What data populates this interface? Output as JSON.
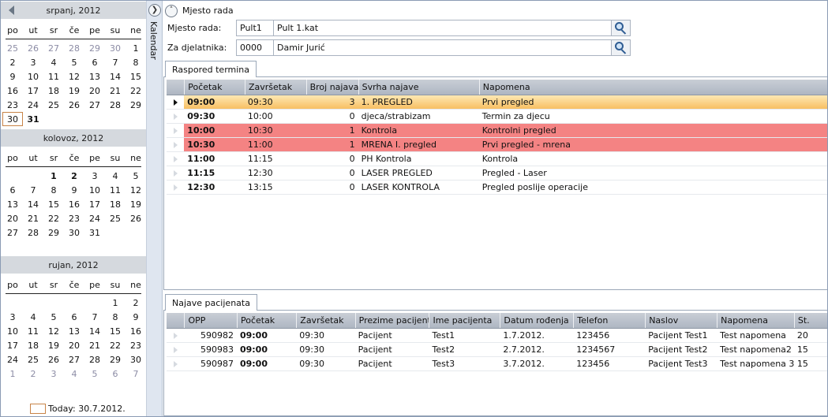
{
  "calendar": {
    "months": [
      {
        "title": "srpanj, 2012",
        "weekdays": [
          "po",
          "ut",
          "sr",
          "če",
          "pe",
          "su",
          "ne"
        ],
        "days": [
          {
            "d": "25",
            "o": true
          },
          {
            "d": "26",
            "o": true
          },
          {
            "d": "27",
            "o": true
          },
          {
            "d": "28",
            "o": true
          },
          {
            "d": "29",
            "o": true
          },
          {
            "d": "30",
            "o": true
          },
          {
            "d": "1"
          },
          {
            "d": "2"
          },
          {
            "d": "3"
          },
          {
            "d": "4"
          },
          {
            "d": "5"
          },
          {
            "d": "6"
          },
          {
            "d": "7"
          },
          {
            "d": "8"
          },
          {
            "d": "9"
          },
          {
            "d": "10"
          },
          {
            "d": "11"
          },
          {
            "d": "12"
          },
          {
            "d": "13"
          },
          {
            "d": "14"
          },
          {
            "d": "15"
          },
          {
            "d": "16"
          },
          {
            "d": "17"
          },
          {
            "d": "18"
          },
          {
            "d": "19"
          },
          {
            "d": "20"
          },
          {
            "d": "21"
          },
          {
            "d": "22"
          },
          {
            "d": "23"
          },
          {
            "d": "24"
          },
          {
            "d": "25"
          },
          {
            "d": "26"
          },
          {
            "d": "27"
          },
          {
            "d": "28"
          },
          {
            "d": "29"
          },
          {
            "d": "30",
            "sel": true
          },
          {
            "d": "31",
            "b": true
          }
        ]
      },
      {
        "title": "kolovoz, 2012",
        "weekdays": [
          "po",
          "ut",
          "sr",
          "če",
          "pe",
          "su",
          "ne"
        ],
        "days": [
          {
            "d": "",
            "e": true
          },
          {
            "d": "",
            "e": true
          },
          {
            "d": "1",
            "b": true
          },
          {
            "d": "2",
            "b": true
          },
          {
            "d": "3"
          },
          {
            "d": "4"
          },
          {
            "d": "5"
          },
          {
            "d": "6"
          },
          {
            "d": "7"
          },
          {
            "d": "8"
          },
          {
            "d": "9"
          },
          {
            "d": "10"
          },
          {
            "d": "11"
          },
          {
            "d": "12"
          },
          {
            "d": "13"
          },
          {
            "d": "14"
          },
          {
            "d": "15"
          },
          {
            "d": "16"
          },
          {
            "d": "17"
          },
          {
            "d": "18"
          },
          {
            "d": "19"
          },
          {
            "d": "20"
          },
          {
            "d": "21"
          },
          {
            "d": "22"
          },
          {
            "d": "23"
          },
          {
            "d": "24"
          },
          {
            "d": "25"
          },
          {
            "d": "26"
          },
          {
            "d": "27"
          },
          {
            "d": "28"
          },
          {
            "d": "29"
          },
          {
            "d": "30"
          },
          {
            "d": "31"
          }
        ]
      },
      {
        "title": "rujan, 2012",
        "weekdays": [
          "po",
          "ut",
          "sr",
          "če",
          "pe",
          "su",
          "ne"
        ],
        "days": [
          {
            "d": "",
            "e": true
          },
          {
            "d": "",
            "e": true
          },
          {
            "d": "",
            "e": true
          },
          {
            "d": "",
            "e": true
          },
          {
            "d": "",
            "e": true
          },
          {
            "d": "1"
          },
          {
            "d": "2"
          },
          {
            "d": "3"
          },
          {
            "d": "4"
          },
          {
            "d": "5"
          },
          {
            "d": "6"
          },
          {
            "d": "7"
          },
          {
            "d": "8"
          },
          {
            "d": "9"
          },
          {
            "d": "10"
          },
          {
            "d": "11"
          },
          {
            "d": "12"
          },
          {
            "d": "13"
          },
          {
            "d": "14"
          },
          {
            "d": "15"
          },
          {
            "d": "16"
          },
          {
            "d": "17"
          },
          {
            "d": "18"
          },
          {
            "d": "19"
          },
          {
            "d": "20"
          },
          {
            "d": "21"
          },
          {
            "d": "22"
          },
          {
            "d": "23"
          },
          {
            "d": "24"
          },
          {
            "d": "25"
          },
          {
            "d": "26"
          },
          {
            "d": "27"
          },
          {
            "d": "28"
          },
          {
            "d": "29"
          },
          {
            "d": "30"
          },
          {
            "d": "1",
            "o": true
          },
          {
            "d": "2",
            "o": true
          },
          {
            "d": "3",
            "o": true
          },
          {
            "d": "4",
            "o": true
          },
          {
            "d": "5",
            "o": true
          },
          {
            "d": "6",
            "o": true
          },
          {
            "d": "7",
            "o": true
          }
        ]
      }
    ],
    "today_label": "Today: 30.7.2012."
  },
  "strip": {
    "label": "Kalendar"
  },
  "header": {
    "title": "Mjesto rada"
  },
  "filters": {
    "mjesto": {
      "label": "Mjesto rada:",
      "code": "Pult1",
      "name": "Pult 1.kat"
    },
    "djelatnik": {
      "label": "Za djelatnika:",
      "code": "0000",
      "name": "Damir Jurić"
    }
  },
  "raspored": {
    "tab": "Raspored termina",
    "columns": [
      "Početak",
      "Završetak",
      "Broj najava",
      "Svrha najave",
      "Napomena"
    ],
    "rows": [
      {
        "cells": [
          "09:00",
          "09:30",
          "3",
          "1. PREGLED",
          "Prvi pregled"
        ],
        "hl": "orange",
        "cur": true
      },
      {
        "cells": [
          "09:30",
          "10:00",
          "0",
          "djeca/strabizam",
          "Termin za djecu"
        ],
        "hl": ""
      },
      {
        "cells": [
          "10:00",
          "10:30",
          "1",
          "Kontrola",
          "Kontrolni pregled"
        ],
        "hl": "red"
      },
      {
        "cells": [
          "10:30",
          "11:00",
          "1",
          "MRENA I. pregled",
          "Prvi pregled - mrena"
        ],
        "hl": "red"
      },
      {
        "cells": [
          "11:00",
          "11:15",
          "0",
          "PH Kontrola",
          "Kontrola"
        ],
        "hl": ""
      },
      {
        "cells": [
          "11:15",
          "12:30",
          "0",
          "LASER PREGLED",
          "Pregled - Laser"
        ],
        "hl": ""
      },
      {
        "cells": [
          "12:30",
          "13:15",
          "0",
          "LASER KONTROLA",
          "Pregled poslije operacije"
        ],
        "hl": ""
      }
    ]
  },
  "najave": {
    "tab": "Najave pacijenata",
    "columns": [
      "OPP",
      "Početak",
      "Završetak",
      "Prezime pacijenta",
      "Ime pacijenta",
      "Datum rođenja",
      "Telefon",
      "Naslov",
      "Napomena",
      "St."
    ],
    "rows": [
      {
        "cells": [
          "590982",
          "09:00",
          "09:30",
          "Pacijent",
          "Test1",
          "1.7.2012.",
          "123456",
          "Pacijent Test1",
          "Test napomena",
          "20"
        ]
      },
      {
        "cells": [
          "590983",
          "09:00",
          "09:30",
          "Pacijent",
          "Test2",
          "2.7.2012.",
          "1234567",
          "Pacijent Test2",
          "Test napomena2",
          "15"
        ]
      },
      {
        "cells": [
          "590987",
          "09:00",
          "09:30",
          "Pacijent",
          "Test3",
          "3.7.2012.",
          "123456",
          "Pacijent Test3",
          "Test napomena 3",
          "15"
        ]
      }
    ]
  }
}
